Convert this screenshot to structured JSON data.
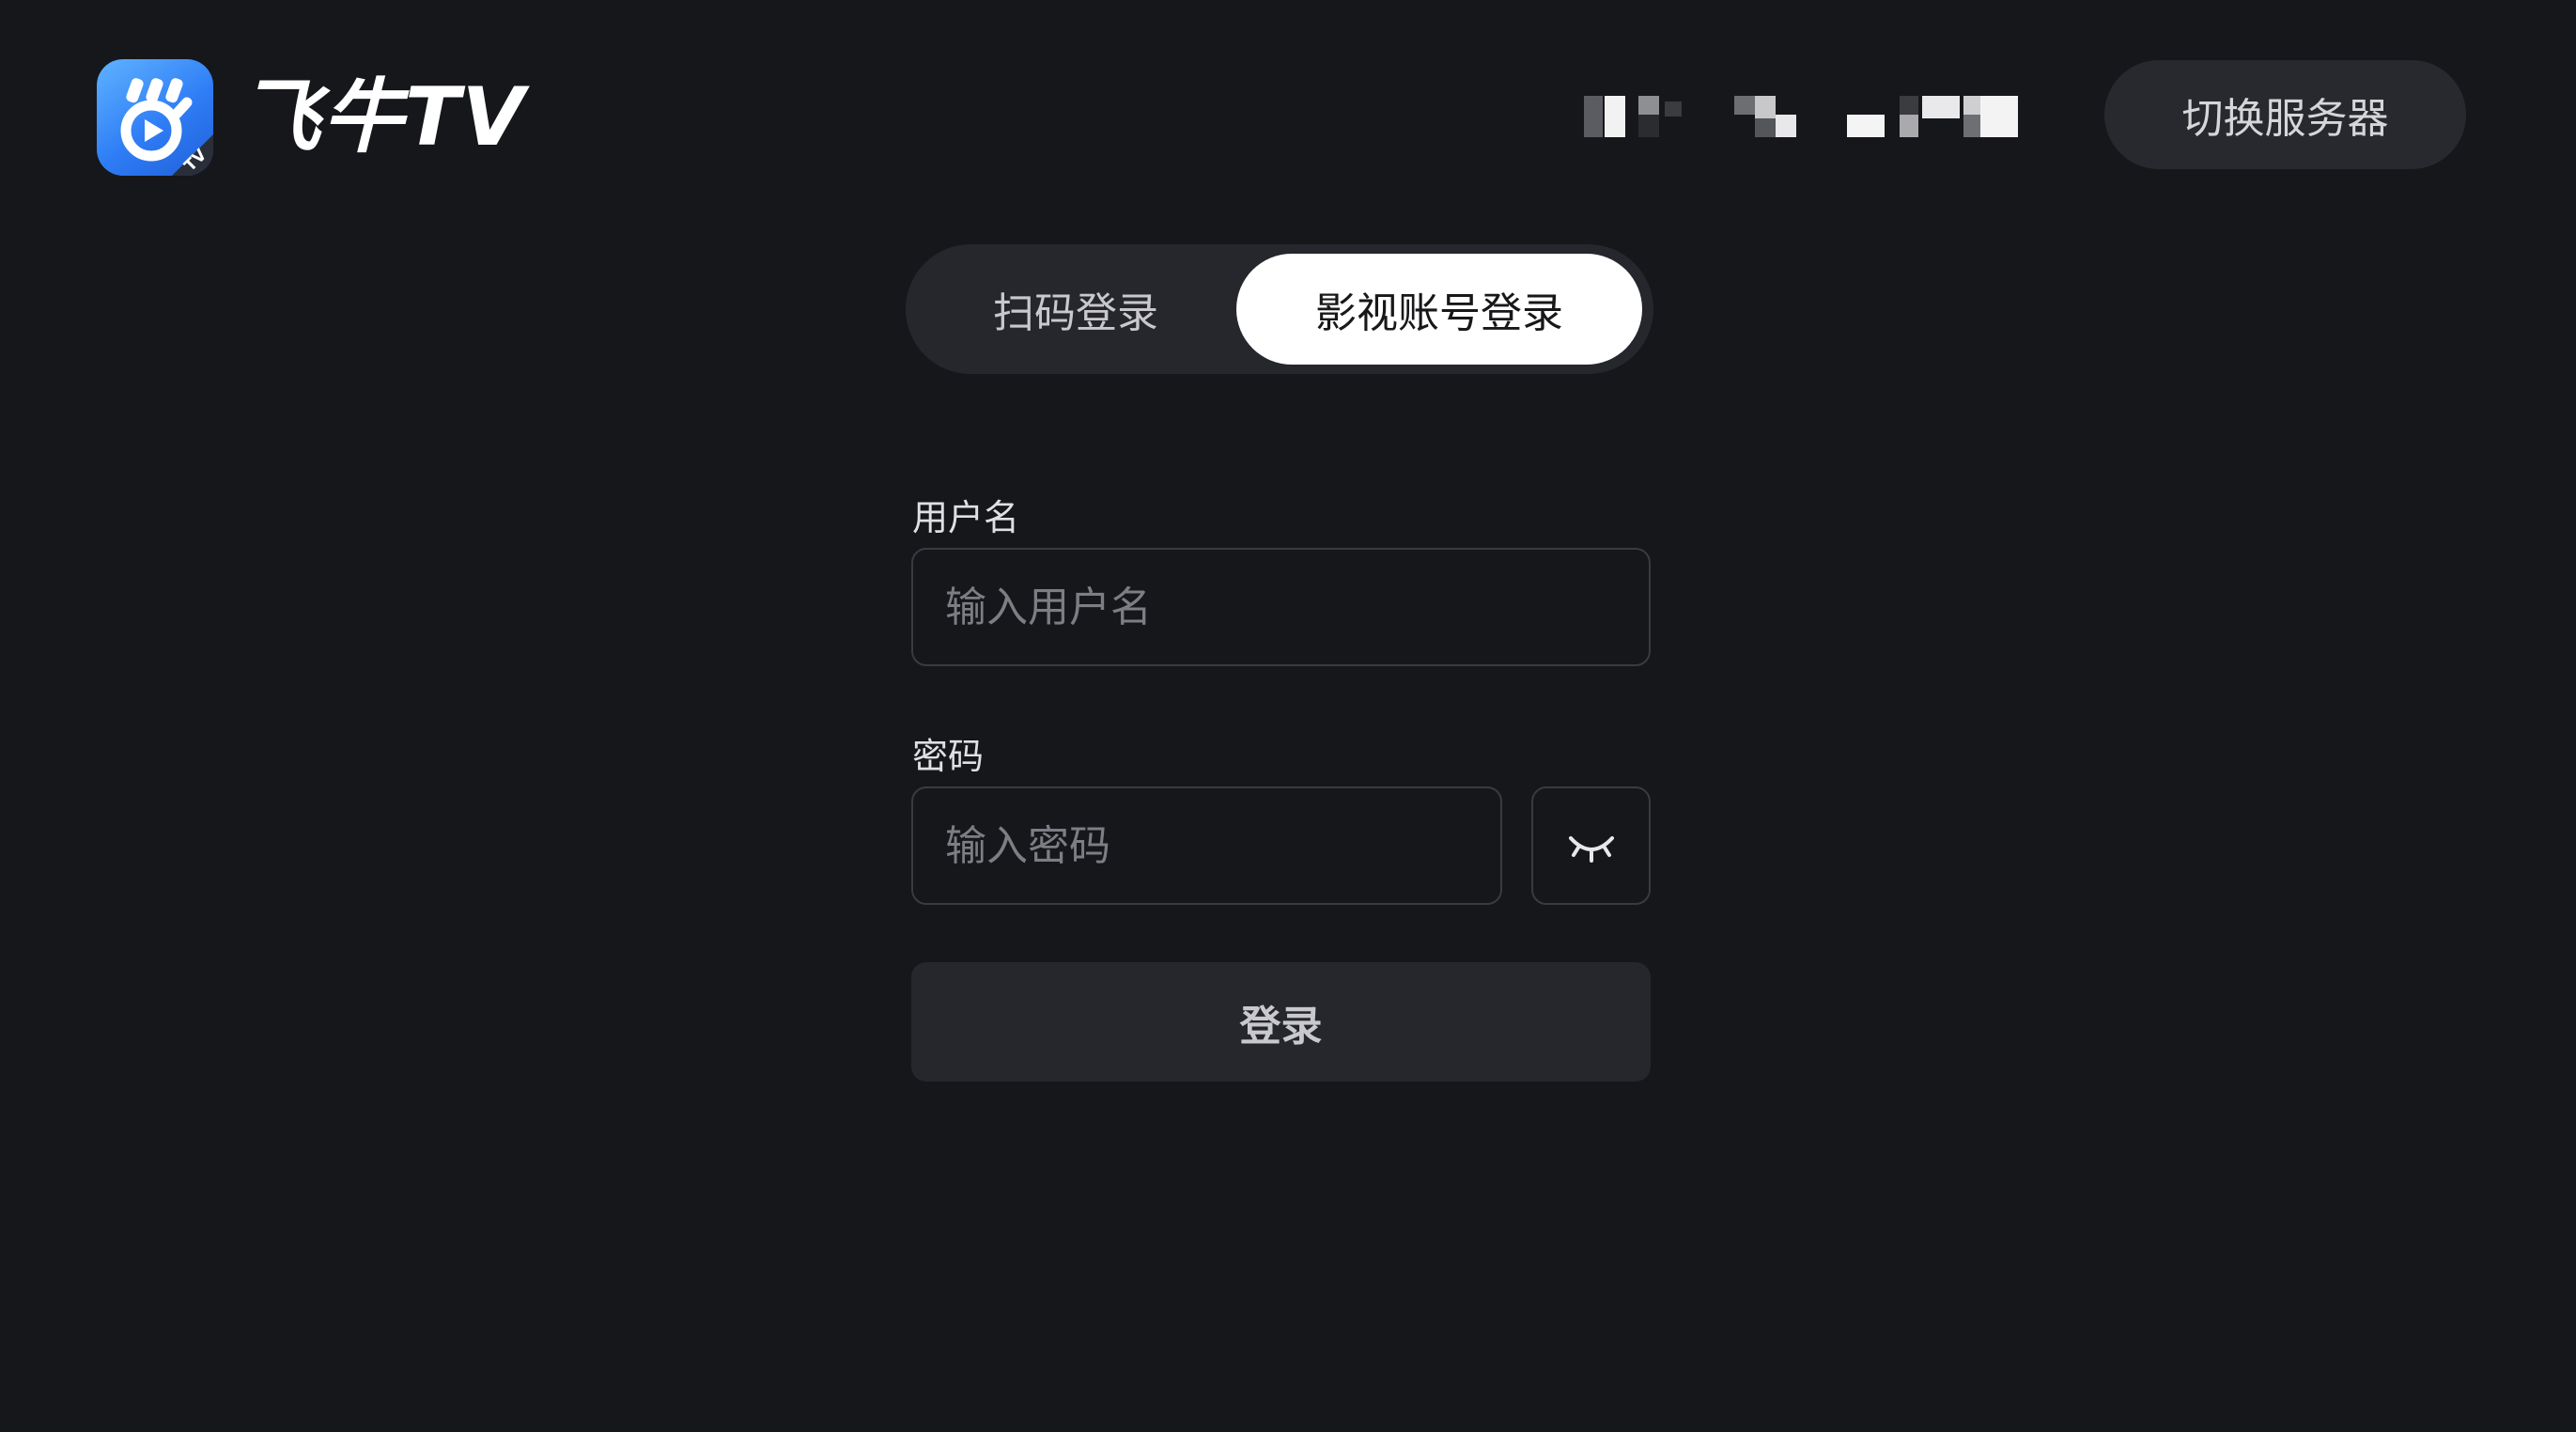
{
  "header": {
    "app_name": "飞牛TV",
    "logo_badge": "TV",
    "switch_server_label": "切换服务器"
  },
  "tabs": [
    {
      "label": "扫码登录",
      "active": false
    },
    {
      "label": "影视账号登录",
      "active": true
    }
  ],
  "form": {
    "username_label": "用户名",
    "username_placeholder": "输入用户名",
    "username_value": "",
    "password_label": "密码",
    "password_placeholder": "输入密码",
    "password_value": "",
    "toggle_icon": "eye-closed-icon",
    "submit_label": "登录"
  },
  "colors": {
    "background": "#16171b",
    "surface": "#26272c",
    "active_tab": "#ffffff",
    "brand_blue": "#2f7df6"
  }
}
